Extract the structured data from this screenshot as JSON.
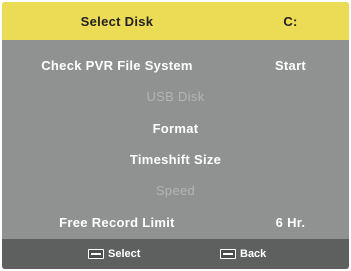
{
  "menu": {
    "select_disk": {
      "label": "Select Disk",
      "value": "C:"
    },
    "check_pvr": {
      "label": "Check PVR File System",
      "value": "Start"
    },
    "usb_disk": {
      "label": "USB Disk"
    },
    "format": {
      "label": "Format"
    },
    "timeshift_size": {
      "label": "Timeshift Size"
    },
    "speed": {
      "label": "Speed"
    },
    "free_record_limit": {
      "label": "Free Record Limit",
      "value": "6 Hr."
    }
  },
  "footer": {
    "select_label": "Select",
    "back_label": "Back",
    "select_icon": "enter-key-icon",
    "back_icon": "menu-key-icon"
  },
  "colors": {
    "highlight": "#ecdc55",
    "panel": "#8f9290",
    "footer": "#5d605e"
  }
}
